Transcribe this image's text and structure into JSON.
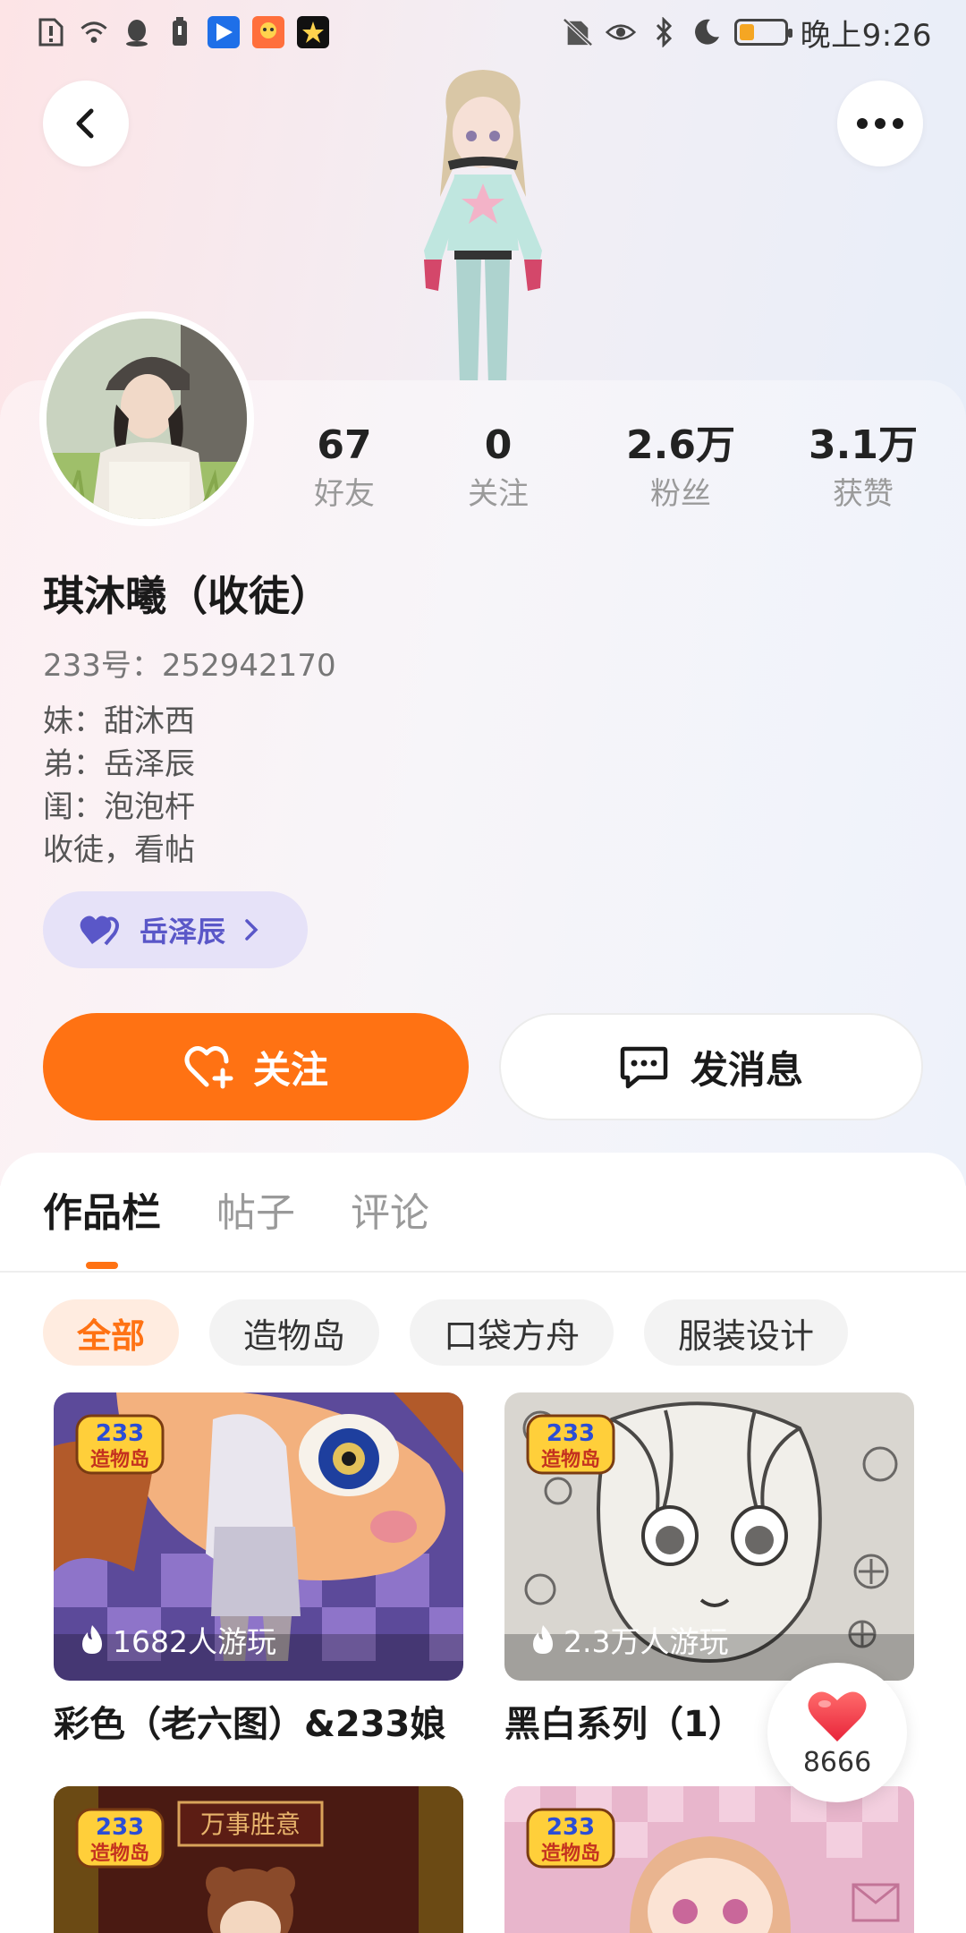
{
  "status_bar": {
    "time": "晚上9:26"
  },
  "profile": {
    "name": "琪沐曦（收徒）",
    "uid_text": "233号：252942170",
    "bio_lines": [
      "妹：甜沐西",
      "弟：岳泽辰",
      "闺：泡泡杆",
      "收徒，看帖"
    ],
    "relation": "岳泽辰"
  },
  "stats": [
    {
      "value": "67",
      "label": "好友"
    },
    {
      "value": "0",
      "label": "关注"
    },
    {
      "value": "2.6万",
      "label": "粉丝"
    },
    {
      "value": "3.1万",
      "label": "获赞"
    }
  ],
  "actions": {
    "follow": "关注",
    "message": "发消息"
  },
  "tabs": [
    "作品栏",
    "帖子",
    "评论"
  ],
  "filters": [
    "全部",
    "造物岛",
    "口袋方舟",
    "服装设计"
  ],
  "badge": {
    "number": "233",
    "name": "造物岛"
  },
  "works": [
    {
      "title": "彩色（老六图）&233娘",
      "plays": "1682人游玩"
    },
    {
      "title": "黑白系列（1）",
      "plays": "2.3万人游玩"
    },
    {
      "title": "",
      "plays": "",
      "banner": "万事胜意"
    },
    {
      "title": "",
      "plays": ""
    }
  ],
  "like_float": {
    "count": "8666"
  },
  "colors": {
    "accent": "#ff7213",
    "relation_chip": "#e6e2f8",
    "relation_text": "#5a57c8"
  }
}
